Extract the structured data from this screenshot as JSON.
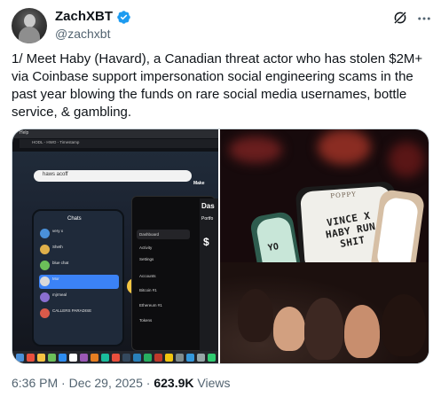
{
  "author": {
    "display_name": "ZachXBT",
    "handle": "@zachxbt",
    "verified": true
  },
  "header_icons": {
    "grok": "grok-icon",
    "more": "more-icon"
  },
  "tweet": {
    "text": "1/ Meet Haby (Havard), a Canadian threat actor who has stolen $2M+ via Coinbase support impersonation social engineering scams in the past year blowing the funds on rare social media usernames, bottle service, & gambling."
  },
  "media": {
    "left_image": {
      "menu_left": "Help",
      "tab_title": "HODL - HWO - Timestamp",
      "search_query": "haws acoff",
      "phone_header": "Chats",
      "chats": [
        {
          "name": "very x",
          "preview": "Yes"
        },
        {
          "name": "Sheth",
          "preview": "oh"
        },
        {
          "name": "blue chat",
          "preview": "https://..."
        },
        {
          "name": "Mor",
          "preview": "yes"
        },
        {
          "name": "mjrmeal",
          "preview": "cyan i can"
        },
        {
          "name": "CALLERS PARADISE",
          "preview": "Uhm"
        }
      ],
      "wallet_items": [
        "Dashboard",
        "Activity",
        "Settings",
        "Accounts",
        "Bitcoin #1",
        "Ethereum #1",
        "Tokens"
      ],
      "wallet_side_label": "Das",
      "wallet_side_sub": "Portfo",
      "wallet_side_symbol": "$",
      "make_label": "Make"
    },
    "right_image": {
      "sign_text": "VINCE X HABY RUN SHIT",
      "sign_brand": "POPPY",
      "side_letters": "YO"
    }
  },
  "footer": {
    "time": "6:36 PM",
    "separator": "·",
    "date": "Dec 29, 2025",
    "views_count": "623.9K",
    "views_label": "Views"
  },
  "colors": {
    "text_primary": "#0f1419",
    "text_secondary": "#536471",
    "verified_blue": "#1d9bf0",
    "border": "#cfd9de"
  }
}
